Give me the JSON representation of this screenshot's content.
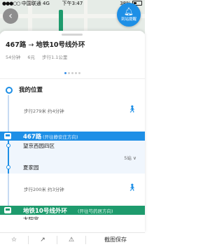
{
  "status_bar": {
    "carrier": "中国联通",
    "network": "4G",
    "time": "下午3:47",
    "battery": "38%"
  },
  "map": {
    "share_button_label": "到站提醒"
  },
  "route": {
    "from": "467路",
    "to": "地铁10号线外环",
    "duration": "54分钟",
    "fare": "6元",
    "walk_total": "步行1.1公里",
    "page_count": 5,
    "active_page": 1
  },
  "steps": {
    "start_label": "我的位置",
    "walk1": "步行279米 约4分钟",
    "bus": {
      "name": "467路",
      "direction": "(开往静安庄方向)",
      "board_stop": "望京西园四区",
      "stops_count": "5站",
      "alight_stop": "夏家园"
    },
    "walk2": "步行200米 约3分钟",
    "subway": {
      "name": "地铁10号线外环",
      "direction": "(开往芍药居方向)",
      "next_stop_partial": "太阳宫"
    }
  },
  "toolbar": {
    "save_label": "截图保存"
  },
  "colors": {
    "bus_blue": "#1e8fe6",
    "subway_green": "#1e9b6d"
  }
}
